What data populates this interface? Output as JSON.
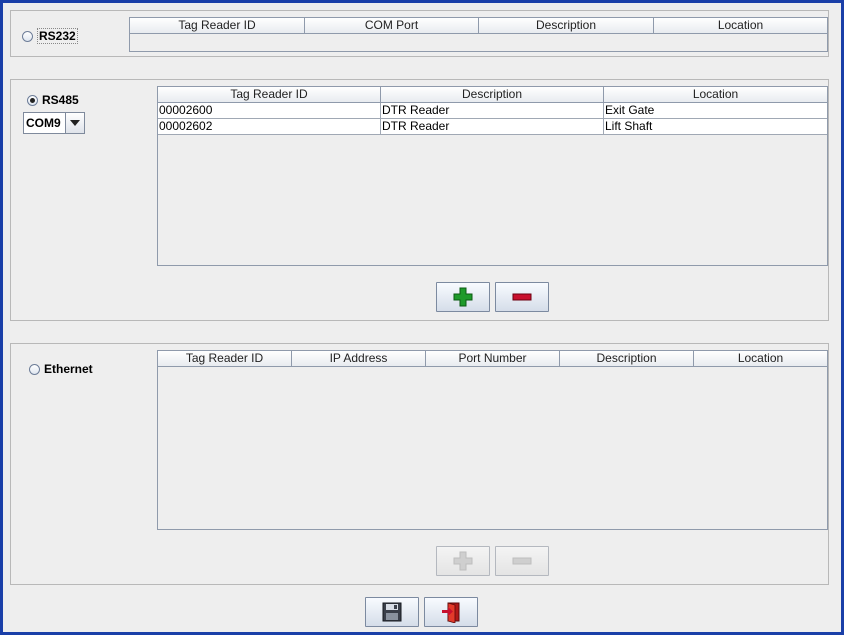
{
  "rs232": {
    "label": "RS232",
    "selected": false,
    "columns": [
      "Tag Reader ID",
      "COM Port",
      "Description",
      "Location"
    ]
  },
  "rs485": {
    "label": "RS485",
    "selected": true,
    "com_port": "COM9",
    "columns": [
      "Tag Reader ID",
      "Description",
      "Location"
    ],
    "rows": [
      {
        "id": "00002600",
        "description": "DTR Reader",
        "location": "Exit Gate"
      },
      {
        "id": "00002602",
        "description": "DTR Reader",
        "location": "Lift Shaft"
      }
    ],
    "add_icon": "plus-icon",
    "remove_icon": "minus-icon"
  },
  "ethernet": {
    "label": "Ethernet",
    "selected": false,
    "columns": [
      "Tag Reader ID",
      "IP Address",
      "Port Number",
      "Description",
      "Location"
    ],
    "add_icon": "plus-icon",
    "remove_icon": "minus-icon"
  },
  "footer": {
    "save_icon": "floppy-disk-icon",
    "exit_icon": "exit-door-icon"
  },
  "colors": {
    "window_border": "#1a3fa8",
    "add_green": "#1e9a2a",
    "remove_red": "#c8102e"
  }
}
